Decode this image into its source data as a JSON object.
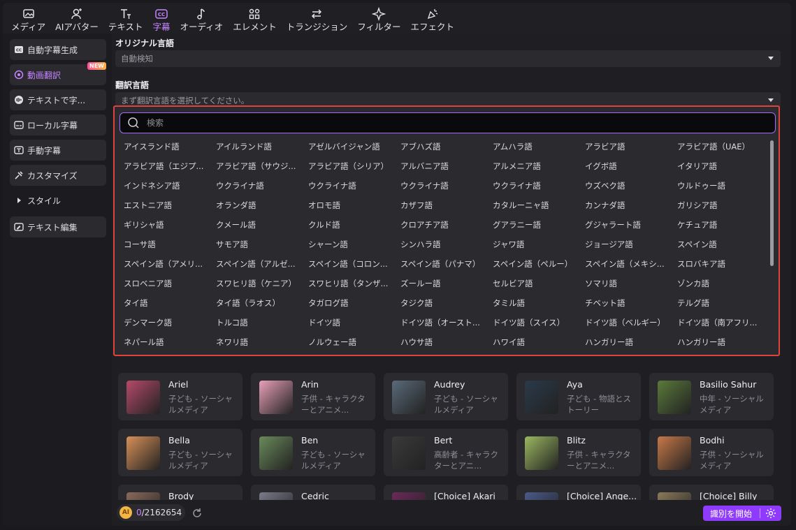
{
  "toolbar": {
    "tabs": [
      {
        "label": "メディア",
        "icon": "media-icon",
        "active": false
      },
      {
        "label": "AIアバター",
        "icon": "avatar-icon",
        "active": false
      },
      {
        "label": "テキスト",
        "icon": "text-icon",
        "active": false
      },
      {
        "label": "字幕",
        "icon": "subtitle-icon",
        "active": true
      },
      {
        "label": "オーディオ",
        "icon": "audio-icon",
        "active": false
      },
      {
        "label": "エレメント",
        "icon": "element-icon",
        "active": false
      },
      {
        "label": "トランジション",
        "icon": "transition-icon",
        "active": false
      },
      {
        "label": "フィルター",
        "icon": "filter-icon",
        "active": false
      },
      {
        "label": "エフェクト",
        "icon": "effect-icon",
        "active": false
      }
    ]
  },
  "sidebar": {
    "items": [
      {
        "label": "自動字幕生成",
        "icon": "cc-icon"
      },
      {
        "label": "動画翻訳",
        "icon": "translate-icon",
        "active": true,
        "badge": "NEW"
      },
      {
        "label": "テキストで字...",
        "icon": "text-to-subtitle-icon"
      },
      {
        "label": "ローカル字幕",
        "icon": "local-subtitle-icon"
      },
      {
        "label": "手動字幕",
        "icon": "manual-subtitle-icon"
      },
      {
        "label": "カスタマイズ",
        "icon": "customize-icon"
      },
      {
        "label": "スタイル",
        "icon": "triangle-right-icon"
      },
      {
        "label": "テキスト編集",
        "icon": "text-edit-icon"
      }
    ]
  },
  "main": {
    "original_label": "オリジナル言語",
    "original_value": "自動検知",
    "translate_label": "翻訳言語",
    "translate_placeholder": "まず翻訳言語を選択してください。"
  },
  "dropdown": {
    "search_placeholder": "検索",
    "languages": [
      "アイスランド語",
      "アイルランド語",
      "アゼルバイジャン語",
      "アブハズ語",
      "アムハラ語",
      "アラビア語",
      "アラビア語（UAE）",
      "アラビア語（エジプ...",
      "アラビア語（サウジ...",
      "アラビア語（シリア）",
      "アルバニア語",
      "アルメニア語",
      "イグボ語",
      "イタリア語",
      "インドネシア語",
      "ウクライナ語",
      "ウクライナ語",
      "ウクライナ語",
      "ウクライナ語",
      "ウズベク語",
      "ウルドゥー語",
      "エストニア語",
      "オランダ語",
      "オロモ語",
      "カザフ語",
      "カタルーニャ語",
      "カンナダ語",
      "ガリシア語",
      "ギリシャ語",
      "クメール語",
      "クルド語",
      "クロアチア語",
      "グアラニー語",
      "グジャラート語",
      "ケチュア語",
      "コーサ語",
      "サモア語",
      "シャーン語",
      "シンハラ語",
      "ジャワ語",
      "ジョージア語",
      "スペイン語",
      "スペイン語（アメリ...",
      "スペイン語（アルゼ...",
      "スペイン語（コロン...",
      "スペイン語（パナマ）",
      "スペイン語（ペルー）",
      "スペイン語（メキシ...",
      "スロバキア語",
      "スロベニア語",
      "スワヒリ語（ケニア）",
      "スワヒリ語（タンザ...",
      "ズールー語",
      "セルビア語",
      "ソマリ語",
      "ゾンカ語",
      "タイ語",
      "タイ語（ラオス）",
      "タガログ語",
      "タジク語",
      "タミル語",
      "チベット語",
      "テルグ語",
      "デンマーク語",
      "トルコ語",
      "ドイツ語",
      "ドイツ語（オースト...",
      "ドイツ語（スイス）",
      "ドイツ語（ベルギー）",
      "ドイツ語（南アフリ...",
      "ネパール語",
      "ネワリ語",
      "ノルウェー語",
      "ハウサ語",
      "ハワイ語",
      "ハンガリー語",
      "ハンガリー語"
    ]
  },
  "voices": [
    {
      "name": "Ariel",
      "desc": "子ども - ソーシャルメディア"
    },
    {
      "name": "Arin",
      "desc": "子供 - キャラクターとアニメ..."
    },
    {
      "name": "Audrey",
      "desc": "子ども - ソーシャルメディア"
    },
    {
      "name": "Aya",
      "desc": "子ども - 物語とストーリー"
    },
    {
      "name": "Basilio Sahur",
      "desc": "中年 - ソーシャルメディア"
    },
    {
      "name": "Bella",
      "desc": "子ども - ソーシャルメディア"
    },
    {
      "name": "Ben",
      "desc": "子ども - ソーシャルメディア"
    },
    {
      "name": "Bert",
      "desc": "高齢者 - キャラクターとアニ..."
    },
    {
      "name": "Blitz",
      "desc": "子供 - キャラクターとアニメ..."
    },
    {
      "name": "Bodhi",
      "desc": "子供 - ソーシャルメディア"
    },
    {
      "name": "Brody",
      "desc": ""
    },
    {
      "name": "Cedric",
      "desc": ""
    },
    {
      "name": "[Choice] Akari",
      "desc": ""
    },
    {
      "name": "[Choice] Ange...",
      "desc": ""
    },
    {
      "name": "[Choice] Billy",
      "desc": ""
    }
  ],
  "bottom": {
    "coin_label": "AI",
    "credits_used": "0",
    "credits_total": "/2162654",
    "start_button": "識別を開始"
  },
  "colors": {
    "accent": "#8f3bff",
    "active_text": "#c585ff",
    "highlight_border": "#e0423c"
  }
}
